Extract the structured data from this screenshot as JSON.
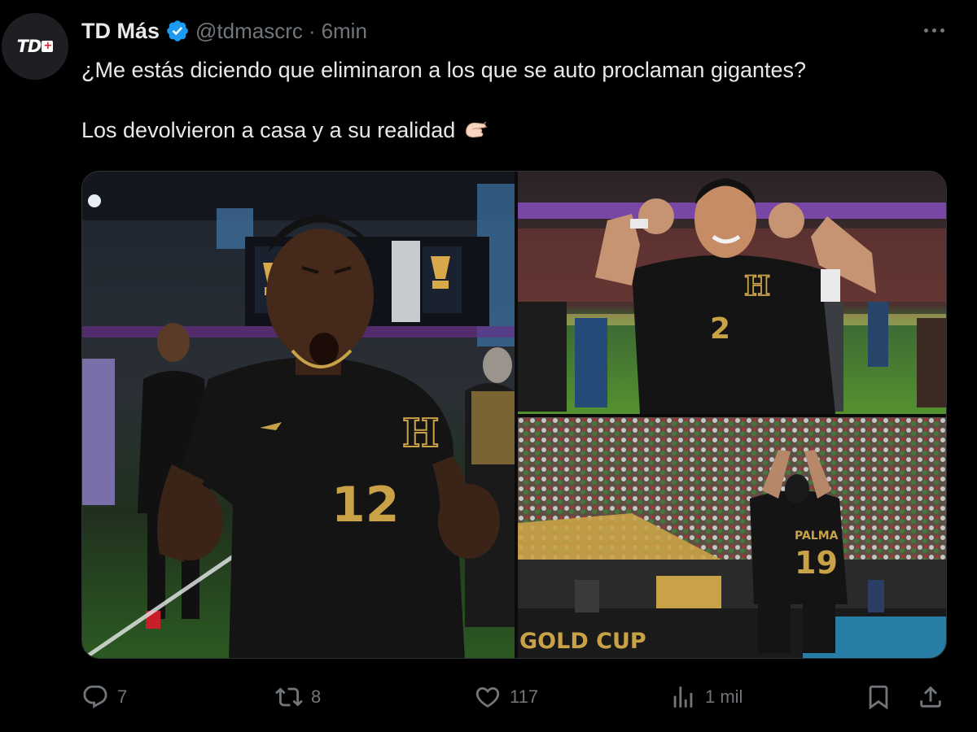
{
  "tweet": {
    "author": {
      "display_name": "TD Más",
      "handle": "@tdmascrc",
      "avatar_text": "TD",
      "verified": true
    },
    "separator": "·",
    "time": "6min",
    "text_line_1": "¿Me estás diciendo que eliminaron a los que se auto proclaman gigantes?",
    "text_line_2": "Los devolvieron a casa y a su realidad",
    "emoji": "pinching-hand"
  },
  "media": {
    "photos": [
      {
        "name": "player-12-celebrating",
        "jersey_number": "12",
        "crest": "H"
      },
      {
        "name": "player-2-flexing",
        "jersey_number": "2",
        "crest": "H"
      },
      {
        "name": "player-19-celebrating",
        "jersey_number": "19",
        "jersey_name": "PALMA",
        "board_text": "GOLD CUP"
      }
    ]
  },
  "actions": {
    "replies": "7",
    "reposts": "8",
    "likes": "117",
    "views": "1 mil"
  },
  "colors": {
    "background": "#000000",
    "text": "#e7e9ea",
    "muted": "#71767b",
    "verified": "#1d9bf0"
  }
}
